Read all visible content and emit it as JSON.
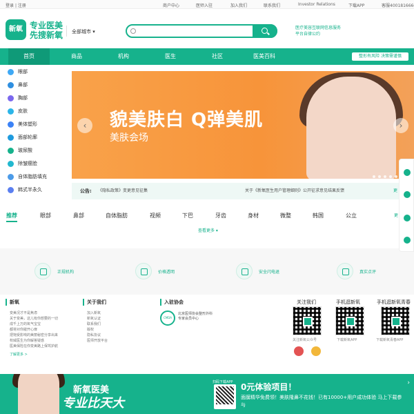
{
  "topbar": {
    "login": "登录",
    "sep": "|",
    "register": "注册",
    "links": [
      "商户中心",
      "医师入驻",
      "加入我们",
      "联系我们",
      "Investor Relations",
      "下载APP",
      "客服4001816660"
    ]
  },
  "header": {
    "logo_mark": "新氧",
    "logo_line1": "专业医美",
    "logo_line2": "先搜新氧",
    "city": "全部城市 ▾",
    "search_placeholder": "",
    "slogan_line1": "医疗美容互联网信息服务",
    "slogan_line2": "平台自律公约"
  },
  "nav": {
    "items": [
      "首页",
      "商品",
      "机构",
      "医生",
      "社区",
      "医美百科"
    ],
    "tag": "整形有风险 决策需谨慎"
  },
  "sidebar": {
    "items": [
      "眼部",
      "鼻部",
      "胸部",
      "皮肤",
      "美体塑形",
      "面部轮廓",
      "玻尿酸",
      "除皱瘦脸",
      "自体脂肪填充",
      "韩式半永久"
    ]
  },
  "banner": {
    "title": "貌美肤白 Q弹美肌",
    "subtitle": "美肤会场",
    "prev": "‹",
    "next": "›"
  },
  "notice": {
    "label": "公告:",
    "n1": "《隐私政策》变更意见征集",
    "n2": "关于《新氧医生用户管理细则》公开征求意见结果反馈",
    "more": "更"
  },
  "tabs": {
    "items": [
      "推荐",
      "眼部",
      "鼻部",
      "自体脂肪",
      "视频",
      "下巴",
      "牙齿",
      "身材",
      "微整",
      "韩国",
      "公立"
    ],
    "more_right": "更"
  },
  "more_link": "查看更多 ▾",
  "features": [
    "正规机构",
    "价格透明",
    "安全闪电退",
    "真实点评"
  ],
  "footer": {
    "col1": {
      "title": "新氧",
      "lines": [
        "变美况才不是焦虑",
        "关于变美，这儿有你想要的一切",
        "成千上万的氧气宝宝",
        "都将对你敞开心扉",
        "把饱受影响的美丽秘密分享出来",
        "权威医生为你解答疑惑",
        "医美保险在你变美路上保驾护航"
      ],
      "more": "了解更多 >"
    },
    "col2": {
      "title": "关于我们",
      "lines": [
        "加入新氧",
        "新氧认证",
        "联系我们",
        "版权",
        "隐私协议",
        "医师开放平台"
      ]
    },
    "col3": {
      "title": "入驻协会",
      "assoc_line1": "北京医师协会整形外科",
      "assoc_line2": "专家会员中心",
      "emblem": "CMDA"
    },
    "qr1": {
      "title": "关注我们",
      "caption": "关注新氧公众号"
    },
    "qr2": {
      "title": "手机逛新氧",
      "caption": "下载新氧APP"
    },
    "qr3": {
      "title": "手机逛新氧青春",
      "caption": "下载新氧青春APP"
    }
  },
  "bottom_banner": {
    "brand": "新氧医美",
    "slogan": "专业比天大",
    "scan": "扫码下载APP",
    "promo_title": "0元体验项目！",
    "promo_text": "面膜精华免费领！美肤隆鼻不花钱！已有10000+用户成功体验 马上下载参与",
    "close": "›"
  }
}
